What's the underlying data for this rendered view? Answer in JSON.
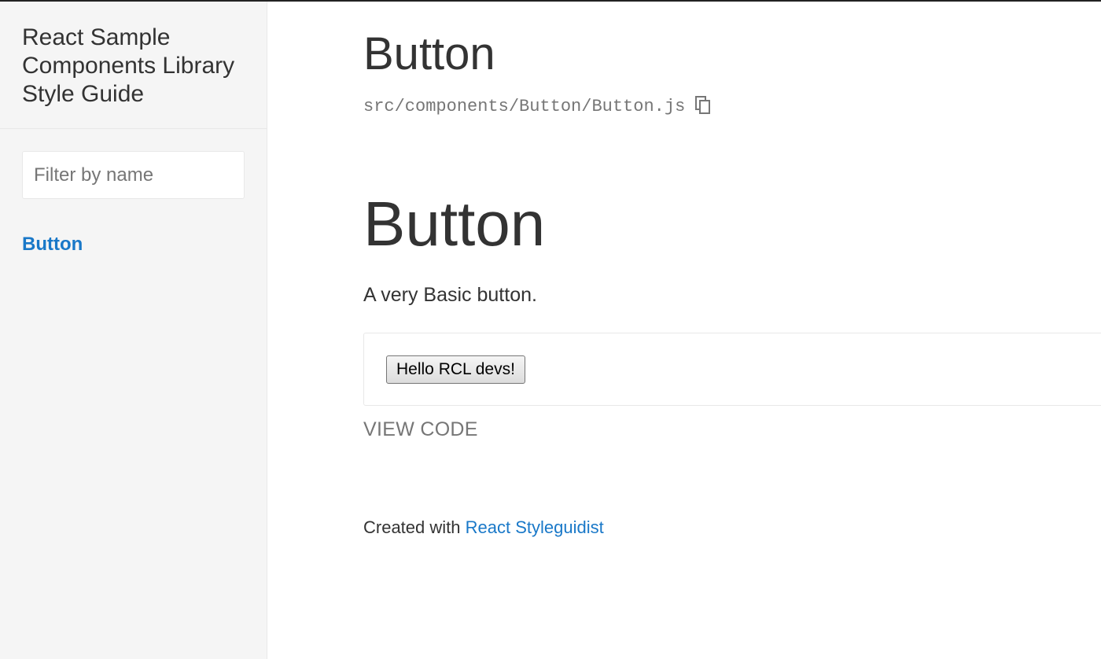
{
  "sidebar": {
    "title": "React Sample Components Library Style Guide",
    "filter": {
      "placeholder": "Filter by name",
      "value": ""
    },
    "items": [
      {
        "label": "Button"
      }
    ]
  },
  "main": {
    "page_title": "Button",
    "file_path": "src/components/Button/Button.js",
    "copy_icon": "copy-icon",
    "section_title": "Button",
    "description": "A very Basic button.",
    "demo_button_label": "Hello RCL devs!",
    "view_code_label": "VIEW CODE"
  },
  "footer": {
    "prefix": "Created with ",
    "link_text": "React Styleguidist"
  },
  "colors": {
    "link": "#1978c8",
    "muted": "#767676",
    "sidebar_bg": "#f5f5f5",
    "border": "#e8e8e8",
    "text": "#333333"
  }
}
